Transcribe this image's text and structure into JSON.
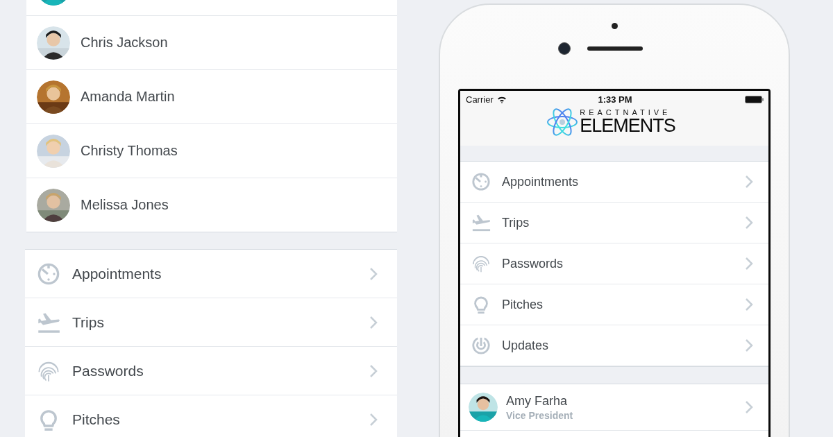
{
  "contacts_panel": {
    "contacts": [
      {
        "name": "Chris Jackson"
      },
      {
        "name": "Amanda Martin"
      },
      {
        "name": "Christy Thomas"
      },
      {
        "name": "Melissa Jones"
      }
    ]
  },
  "menu_panel": {
    "items": [
      {
        "label": "Appointments",
        "kind": "timer"
      },
      {
        "label": "Trips",
        "kind": "plane"
      },
      {
        "label": "Passwords",
        "kind": "fingerprint"
      },
      {
        "label": "Pitches",
        "kind": "bulb"
      }
    ]
  },
  "phone": {
    "status_bar": {
      "carrier": "Carrier",
      "time": "1:33 PM"
    },
    "logo": {
      "top": "REACTNATIVE",
      "bottom": "ELEMENTS"
    },
    "menu": [
      {
        "label": "Appointments",
        "kind": "timer"
      },
      {
        "label": "Trips",
        "kind": "plane"
      },
      {
        "label": "Passwords",
        "kind": "fingerprint"
      },
      {
        "label": "Pitches",
        "kind": "bulb"
      },
      {
        "label": "Updates",
        "kind": "updates"
      }
    ],
    "contacts": [
      {
        "name": "Amy Farha",
        "subtitle": "Vice President"
      }
    ]
  }
}
